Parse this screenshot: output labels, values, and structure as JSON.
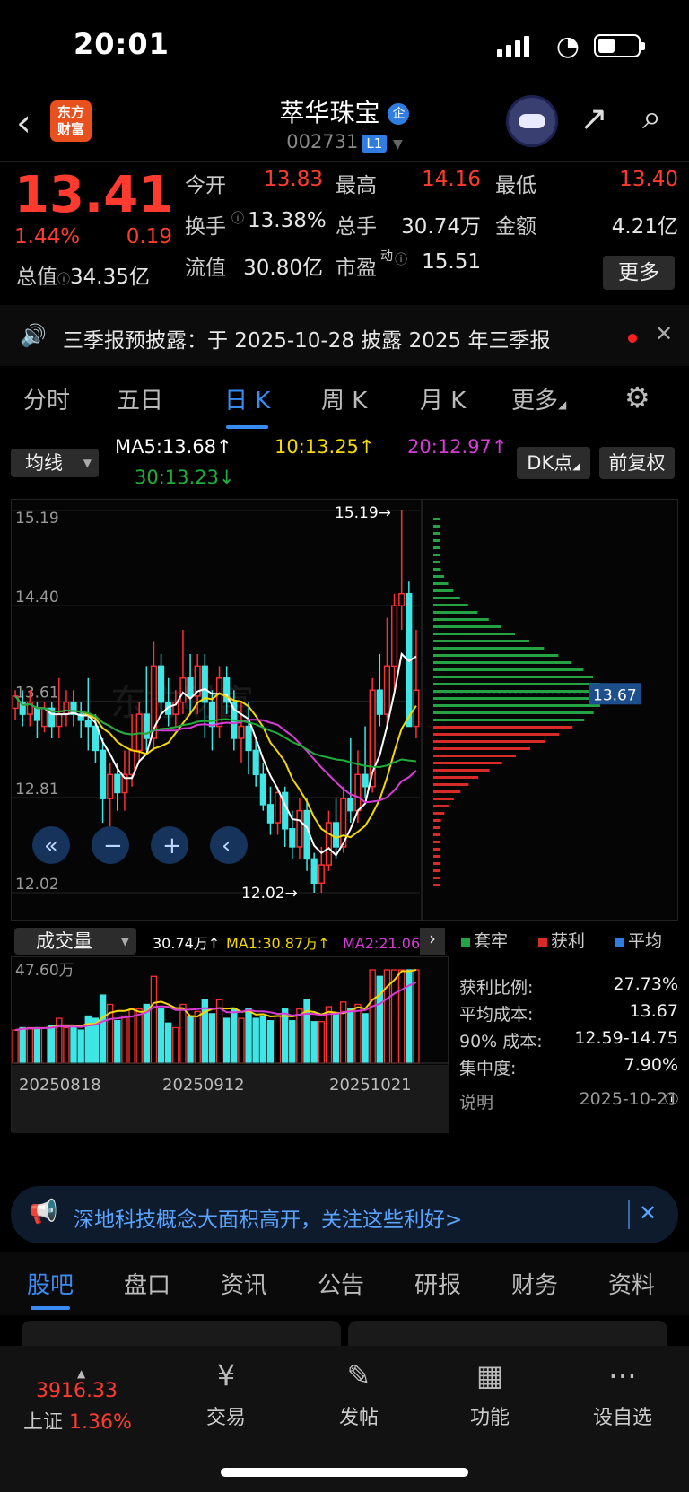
{
  "status": {
    "time": "20:01"
  },
  "header": {
    "logo": "东方\n财富",
    "title": "萃华珠宝",
    "title_badge": "企",
    "code": "002731",
    "level": "L1"
  },
  "quote": {
    "price": "13.41",
    "pct": "1.44%",
    "change": "0.19",
    "total_value_label": "总值",
    "total_value": "34.35亿",
    "rows": [
      [
        {
          "k": "今开",
          "v": "13.83",
          "c": "red"
        },
        {
          "k": "最高",
          "v": "14.16",
          "c": "red"
        },
        {
          "k": "最低",
          "v": "13.40",
          "c": "red"
        }
      ],
      [
        {
          "k": "换手",
          "v": "13.38%",
          "c": "white"
        },
        {
          "k": "总手",
          "v": "30.74万",
          "c": "white"
        },
        {
          "k": "金额",
          "v": "4.21亿",
          "c": "white"
        }
      ],
      [
        {
          "k": "流值",
          "v": "30.80亿",
          "c": "white"
        },
        {
          "k": "市盈",
          "v": "15.51",
          "c": "white"
        }
      ]
    ],
    "pe_sup": "动",
    "more": "更多"
  },
  "notice": {
    "text": "三季报预披露：于 2025-10-28 披露 2025 年三季报"
  },
  "tabs": [
    "分时",
    "五日",
    "日 K",
    "周 K",
    "月 K",
    "更多"
  ],
  "ma": {
    "selector": "均线",
    "ma5": "MA5:13.68↑",
    "ma10": "10:13.25↑",
    "ma20": "20:12.97↑",
    "ma30": "30:13.23↓",
    "dk": "DK点",
    "fq": "前复权"
  },
  "chart": {
    "y_labels": [
      "15.19",
      "14.40",
      "13.61",
      "12.81",
      "12.02"
    ],
    "high_label": "15.19→",
    "low_label": "12.02→",
    "chip_avg": "13.67",
    "watermark": "东方财富"
  },
  "chart_data": {
    "type": "candlestick",
    "x_labels": [
      "20250818",
      "20250912",
      "20251021"
    ],
    "ylim": [
      12.02,
      15.19
    ],
    "candles": [
      [
        13.55,
        13.65,
        13.45,
        13.7
      ],
      [
        13.6,
        13.5,
        13.4,
        13.7
      ],
      [
        13.5,
        13.6,
        13.4,
        13.7
      ],
      [
        13.55,
        13.45,
        13.3,
        13.6
      ],
      [
        13.4,
        13.55,
        13.35,
        13.6
      ],
      [
        13.55,
        13.4,
        13.3,
        13.6
      ],
      [
        13.4,
        13.5,
        13.3,
        13.8
      ],
      [
        13.5,
        13.6,
        13.4,
        13.7
      ],
      [
        13.6,
        13.5,
        13.4,
        13.7
      ],
      [
        13.5,
        13.45,
        13.3,
        13.6
      ],
      [
        13.45,
        13.4,
        13.2,
        13.8
      ],
      [
        13.4,
        13.2,
        13.1,
        13.5
      ],
      [
        13.2,
        12.8,
        12.6,
        13.3
      ],
      [
        12.8,
        13.0,
        12.4,
        13.1
      ],
      [
        13.0,
        12.85,
        12.7,
        13.1
      ],
      [
        12.85,
        13.0,
        12.7,
        13.2
      ],
      [
        13.0,
        13.2,
        12.9,
        13.5
      ],
      [
        13.2,
        13.5,
        13.1,
        13.6
      ],
      [
        13.5,
        13.3,
        13.2,
        13.9
      ],
      [
        13.3,
        13.9,
        13.2,
        14.1
      ],
      [
        13.9,
        13.6,
        13.5,
        14.0
      ],
      [
        13.6,
        13.5,
        13.4,
        13.8
      ],
      [
        13.5,
        13.6,
        13.4,
        13.7
      ],
      [
        13.6,
        13.8,
        13.5,
        14.2
      ],
      [
        13.8,
        13.65,
        13.5,
        14.0
      ],
      [
        13.65,
        13.9,
        13.5,
        14.0
      ],
      [
        13.9,
        13.6,
        13.3,
        14.0
      ],
      [
        13.6,
        13.4,
        13.2,
        13.7
      ],
      [
        13.4,
        13.8,
        13.3,
        13.9
      ],
      [
        13.8,
        13.6,
        13.5,
        13.9
      ],
      [
        13.6,
        13.3,
        13.2,
        13.7
      ],
      [
        13.3,
        13.4,
        13.1,
        13.6
      ],
      [
        13.4,
        13.2,
        13.0,
        13.6
      ],
      [
        13.2,
        13.0,
        12.9,
        13.3
      ],
      [
        13.0,
        12.75,
        12.7,
        13.1
      ],
      [
        12.75,
        12.6,
        12.5,
        12.9
      ],
      [
        12.6,
        12.85,
        12.5,
        12.9
      ],
      [
        12.85,
        12.55,
        12.4,
        12.9
      ],
      [
        12.55,
        12.4,
        12.3,
        12.7
      ],
      [
        12.4,
        12.7,
        12.3,
        12.8
      ],
      [
        12.7,
        12.3,
        12.2,
        12.8
      ],
      [
        12.3,
        12.1,
        12.02,
        12.35
      ],
      [
        12.1,
        12.25,
        12.02,
        12.4
      ],
      [
        12.25,
        12.6,
        12.2,
        12.7
      ],
      [
        12.6,
        12.4,
        12.3,
        12.8
      ],
      [
        12.4,
        12.8,
        12.35,
        12.9
      ],
      [
        12.8,
        12.7,
        12.6,
        13.3
      ],
      [
        12.7,
        13.0,
        12.6,
        13.2
      ],
      [
        13.0,
        12.9,
        12.8,
        13.4
      ],
      [
        12.9,
        13.7,
        12.85,
        13.8
      ],
      [
        13.7,
        13.5,
        13.4,
        14.0
      ],
      [
        13.5,
        13.9,
        13.4,
        14.3
      ],
      [
        13.9,
        14.4,
        13.7,
        14.5
      ],
      [
        14.4,
        14.5,
        14.2,
        15.19
      ],
      [
        14.5,
        13.4,
        13.4,
        14.6
      ],
      [
        13.4,
        13.7,
        13.3,
        14.2
      ]
    ],
    "volume": {
      "max_label": "47.60万",
      "current": "30.74万↑",
      "ma1": "MA1:30.87万↑",
      "ma2": "MA2:21.06万"
    }
  },
  "volume_selector": "成交量",
  "chips": {
    "legend": [
      {
        "label": "套牢",
        "color": "#25a244"
      },
      {
        "label": "获利",
        "color": "#d92a2a"
      },
      {
        "label": "平均",
        "color": "#2f7de1"
      }
    ],
    "rows": [
      {
        "k": "获利比例:",
        "v": "27.73%"
      },
      {
        "k": "平均成本:",
        "v": "13.67"
      },
      {
        "k": "90% 成本:",
        "v": "12.59-14.75"
      },
      {
        "k": "集中度:",
        "v": "7.90%"
      },
      {
        "k": "说明",
        "v": "2025-10-21"
      }
    ]
  },
  "banner": {
    "text": "深地科技概念大面积高开，关注这些利好>"
  },
  "subtabs": [
    "股吧",
    "盘口",
    "资讯",
    "公告",
    "研报",
    "财务",
    "资料"
  ],
  "bottom": {
    "index_value": "3916.33",
    "index_name": "上证",
    "index_pct": "1.36%",
    "items": [
      {
        "label": "交易",
        "icon": "yuan-exchange-icon"
      },
      {
        "label": "发帖",
        "icon": "edit-icon"
      },
      {
        "label": "功能",
        "icon": "grid-icon"
      },
      {
        "label": "设自选",
        "icon": "more-icon"
      }
    ]
  }
}
